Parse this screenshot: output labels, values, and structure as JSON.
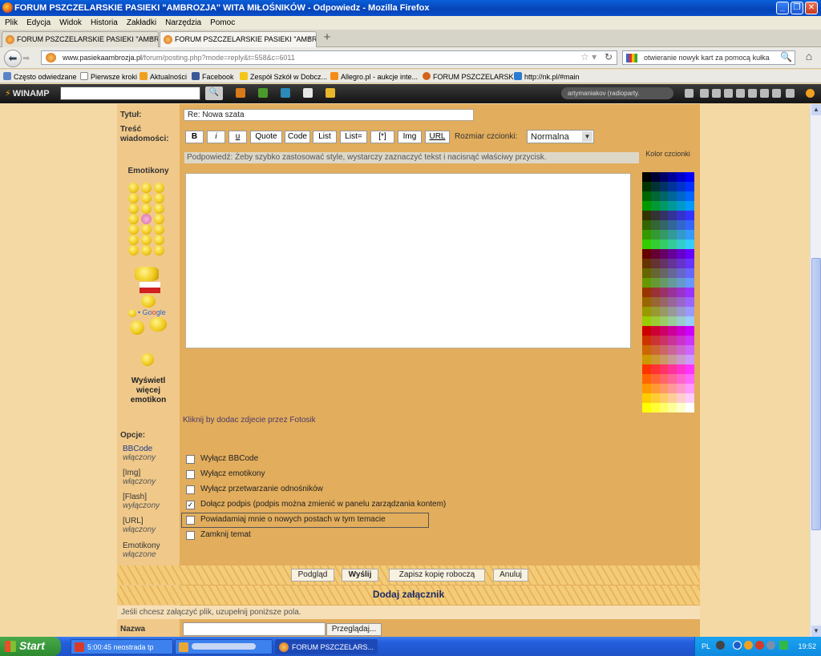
{
  "window": {
    "title": "FORUM PSZCZELARSKIE PASIEKI \"AMBROZJA\" WITA MIŁOŚNIKÓW - Odpowiedz - Mozilla Firefox"
  },
  "menu": [
    "Plik",
    "Edycja",
    "Widok",
    "Historia",
    "Zakładki",
    "Narzędzia",
    "Pomoc"
  ],
  "tabs": [
    {
      "label": "FORUM PSZCZELARSKIE PASIEKI \"AMBR..."
    },
    {
      "label": "FORUM PSZCZELARSKIE PASIEKI \"AMBR..."
    }
  ],
  "nav": {
    "url_domain": "www.pasiekaambrozja.pl",
    "url_path": "/forum/posting.php?mode=reply&t=558&c=6011",
    "search_text": "otwieranie nowyk kart za pomocą kułka"
  },
  "bookmarks": [
    "Często odwiedzane",
    "Pierwsze kroki",
    "Aktualności",
    "Facebook",
    "Zespół Szkół w Dobcz...",
    "Allegro.pl - aukcje inte...",
    "FORUM PSZCZELARSK...",
    "http://nk.pl/#main"
  ],
  "winamp": {
    "logo": "WINAMP",
    "status": "artymaniakov (radioparty."
  },
  "form": {
    "title_label": "Tytuł:",
    "title_value": "Re: Nowa szata",
    "body_label": "Treść wiadomości:",
    "buttons": [
      "B",
      "i",
      "u",
      "Quote",
      "Code",
      "List",
      "List=",
      "[*]",
      "Img",
      "URL"
    ],
    "fontsize_label": "Rozmiar czcionki:",
    "fontsize_value": "Normalna",
    "hint": "Podpowiedź: Żeby szybko zastosować style, wystarczy zaznaczyć tekst i nacisnąć właściwy przycisk.",
    "color_label": "Kolor czcionki",
    "emoticons_label": "Emotikony",
    "more_emoticons": "Wyświetl więcej emotikon",
    "fotosik": "Kliknij by dodac zdjecie przez Fotosik",
    "options_label": "Opcje:",
    "side_options": [
      {
        "name": "BBCode",
        "state": "włączony"
      },
      {
        "name": "[Img]",
        "state": "włączony"
      },
      {
        "name": "[Flash]",
        "state": "wyłączony"
      },
      {
        "name": "[URL]",
        "state": "włączony"
      },
      {
        "name": "Emotikony",
        "state": "włączone"
      }
    ],
    "checkboxes": [
      {
        "label": "Wyłącz BBCode",
        "checked": false
      },
      {
        "label": "Wyłącz emotikony",
        "checked": false
      },
      {
        "label": "Wyłącz przetwarzanie odnośników",
        "checked": false
      },
      {
        "label": "Dołącz podpis (podpis można zmienić w panelu zarządzania kontem)",
        "checked": true
      },
      {
        "label": "Powiadamiaj mnie o nowych postach w tym temacie",
        "checked": false
      },
      {
        "label": "Zamknij temat",
        "checked": false
      }
    ],
    "actions": [
      "Podgląd",
      "Wyślij",
      "Zapisz kopię roboczą",
      "Anuluj"
    ],
    "attach_title": "Dodaj załącznik",
    "attach_text": "Jeśli chcesz załączyć plik, uzupełnij poniższe pola.",
    "name_label": "Nazwa",
    "browse": "Przeglądaj..."
  },
  "taskbar": {
    "start": "Start",
    "tasks": [
      "5:00:45 neostrada tp",
      "",
      "FORUM PSZCZELARS..."
    ],
    "lang": "PL",
    "clock": "19:52"
  }
}
